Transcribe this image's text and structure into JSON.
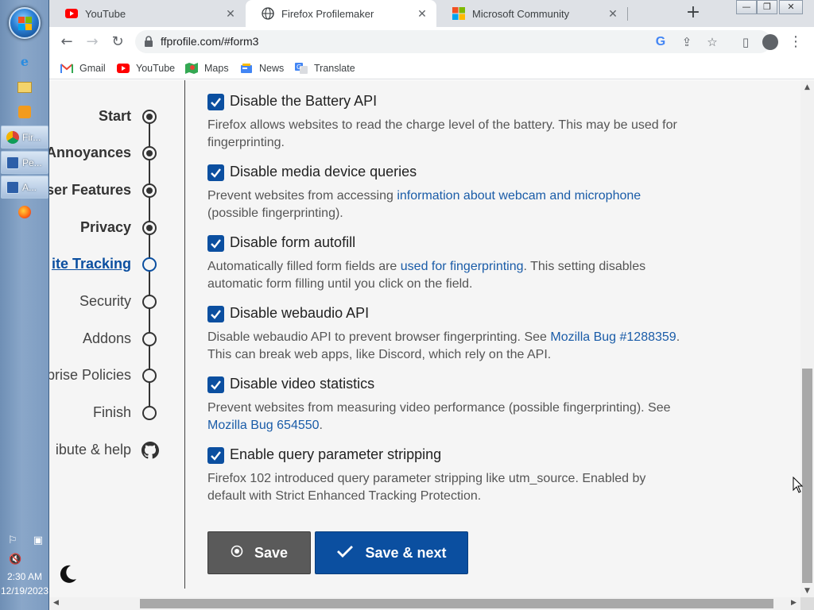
{
  "taskbar": {
    "tasks": [
      {
        "label": "Fir...",
        "icon": "chrome-icon"
      },
      {
        "label": "Pe...",
        "icon": "window-icon"
      },
      {
        "label": "A...",
        "icon": "window-icon"
      }
    ],
    "clock_time": "2:30 AM",
    "clock_date": "12/19/2023"
  },
  "browser": {
    "tabs": [
      {
        "title": "YouTube",
        "icon": "youtube-icon",
        "active": false
      },
      {
        "title": "Firefox Profilemaker",
        "icon": "firefox-icon",
        "active": true
      },
      {
        "title": "Microsoft Community",
        "icon": "microsoft-icon",
        "active": false
      }
    ],
    "url": "ffprofile.com/#form3",
    "bookmarks": [
      {
        "label": "Gmail",
        "icon": "gmail-icon"
      },
      {
        "label": "YouTube",
        "icon": "youtube-icon"
      },
      {
        "label": "Maps",
        "icon": "maps-icon"
      },
      {
        "label": "News",
        "icon": "news-icon"
      },
      {
        "label": "Translate",
        "icon": "translate-icon"
      }
    ]
  },
  "sidebar": {
    "steps": [
      {
        "label": "Start",
        "state": "done"
      },
      {
        "label": "Annoyances",
        "state": "done"
      },
      {
        "label": "ser Features",
        "state": "done"
      },
      {
        "label": "Privacy",
        "state": "done"
      },
      {
        "label": "ite Tracking",
        "state": "current"
      },
      {
        "label": "Security",
        "state": "todo"
      },
      {
        "label": "Addons",
        "state": "todo"
      },
      {
        "label": "prise Policies",
        "state": "todo"
      },
      {
        "label": "Finish",
        "state": "todo"
      }
    ],
    "contribute_label": "ibute & help"
  },
  "options": [
    {
      "title": "Disable the Battery API",
      "checked": true,
      "desc_parts": [
        {
          "text": "Firefox allows websites to read the charge level of the battery. This may be used for fingerprinting."
        }
      ]
    },
    {
      "title": "Disable media device queries",
      "checked": true,
      "desc_parts": [
        {
          "text": "Prevent websites from accessing "
        },
        {
          "text": "information about webcam and microphone",
          "link": true
        },
        {
          "text": " (possible fingerprinting)."
        }
      ]
    },
    {
      "title": "Disable form autofill",
      "checked": true,
      "desc_parts": [
        {
          "text": "Automatically filled form fields are "
        },
        {
          "text": "used for fingerprinting",
          "link": true
        },
        {
          "text": ". This setting disables automatic form filling until you click on the field."
        }
      ]
    },
    {
      "title": "Disable webaudio API",
      "checked": true,
      "desc_parts": [
        {
          "text": "Disable webaudio API to prevent browser fingerprinting. See "
        },
        {
          "text": "Mozilla Bug #1288359",
          "link": true
        },
        {
          "text": ". This can break web apps, like Discord, which rely on the API."
        }
      ]
    },
    {
      "title": "Disable video statistics",
      "checked": true,
      "desc_parts": [
        {
          "text": "Prevent websites from measuring video performance (possible fingerprinting). See "
        },
        {
          "text": "Mozilla Bug 654550",
          "link": true
        },
        {
          "text": "."
        }
      ]
    },
    {
      "title": "Enable query parameter stripping",
      "checked": true,
      "desc_parts": [
        {
          "text": "Firefox 102 introduced query parameter stripping like utm_source. Enabled by default with Strict Enhanced Tracking Protection."
        }
      ]
    }
  ],
  "buttons": {
    "save": "Save",
    "save_next": "Save & next"
  },
  "colors": {
    "accent": "#0b4fa0",
    "link": "#1a5ca8",
    "save_button": "#5a5a5a",
    "page_background": "#f5f5f5"
  }
}
